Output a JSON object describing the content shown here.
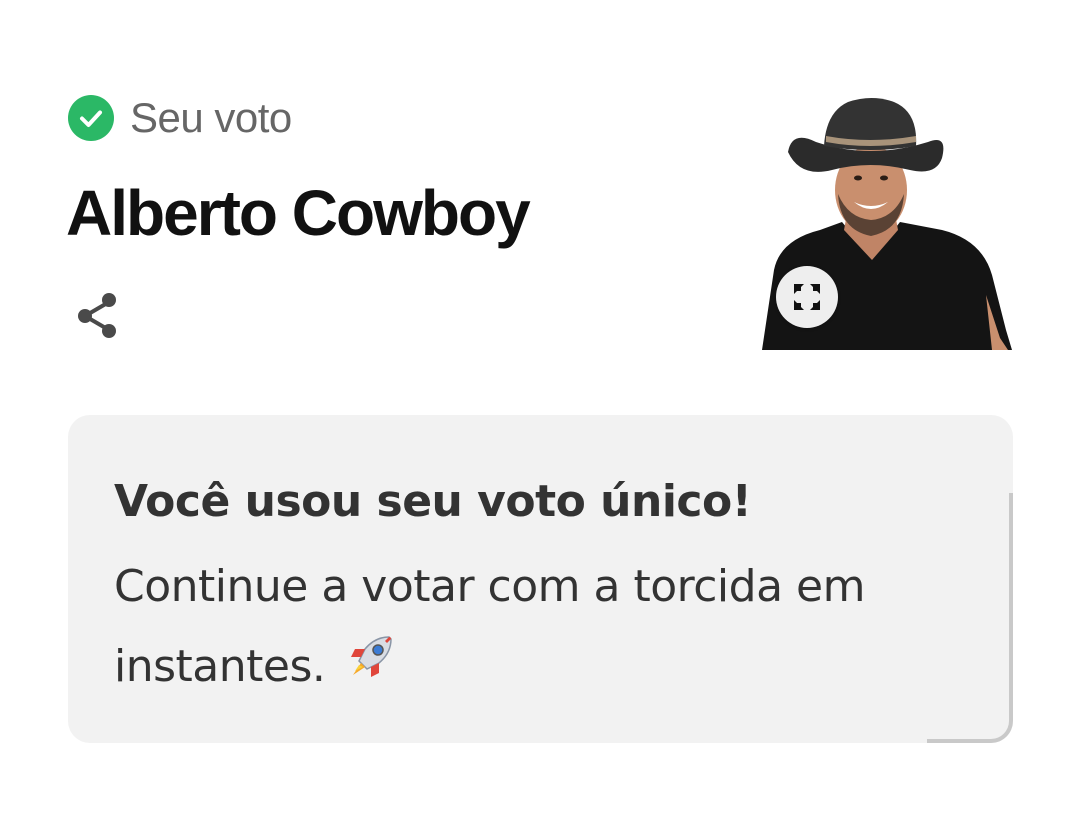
{
  "status": {
    "label": "Seu voto",
    "icon": "check-circle-icon",
    "color": "#2bb866"
  },
  "candidate": {
    "name": "Alberto Cowboy",
    "photo_icon": "expand-icon"
  },
  "actions": {
    "share_icon": "share-icon"
  },
  "notice": {
    "title": "Você usou seu voto único!",
    "body": "Continue a votar com a torcida em instantes.",
    "emoji": "rocket-icon"
  }
}
